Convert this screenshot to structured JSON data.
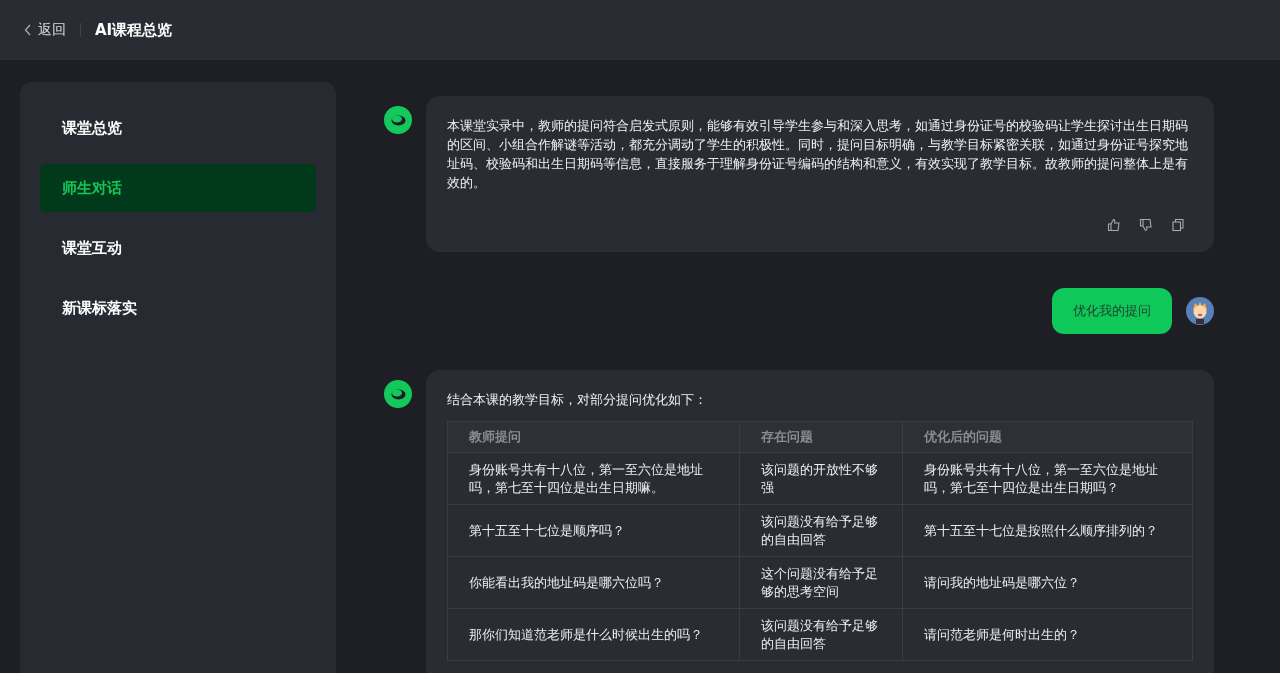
{
  "header": {
    "back": "返回",
    "title": "AI课程总览"
  },
  "sidebar": {
    "items": [
      {
        "label": "课堂总览",
        "selected": false
      },
      {
        "label": "师生对话",
        "selected": true
      },
      {
        "label": "课堂互动",
        "selected": false
      },
      {
        "label": "新课标落实",
        "selected": false
      }
    ]
  },
  "messages": [
    {
      "kind": "ai",
      "text": "本课堂实录中，教师的提问符合启发式原则，能够有效引导学生参与和深入思考，如通过身份证号的校验码让学生探讨出生日期码的区间、小组合作解谜等活动，都充分调动了学生的积极性。同时，提问目标明确，与教学目标紧密关联，如通过身份证号探究地址码、校验码和出生日期码等信息，直接服务于理解身份证号编码的结构和意义，有效实现了教学目标。故教师的提问整体上是有效的。"
    },
    {
      "kind": "user",
      "text": "优化我的提问"
    },
    {
      "kind": "ai_table",
      "text": "结合本课的教学目标，对部分提问优化如下：",
      "table": {
        "columns": [
          "教师提问",
          "存在问题",
          "优化后的问题"
        ],
        "rows": [
          [
            "身份账号共有十八位，第一至六位是地址吗，第七至十四位是出生日期嘛。",
            "该问题的开放性不够强",
            "身份账号共有十八位，第一至六位是地址吗，第七至十四位是出生日期吗？"
          ],
          [
            "第十五至十七位是顺序吗？",
            "该问题没有给予足够的自由回答",
            "第十五至十七位是按照什么顺序排列的？"
          ],
          [
            "你能看出我的地址码是哪六位吗？",
            "这个问题没有给予足够的思考空间",
            "请问我的地址码是哪六位？"
          ],
          [
            "那你们知道范老师是什么时候出生的吗？",
            "该问题没有给予足够的自由回答",
            "请问范老师是何时出生的？"
          ]
        ]
      }
    }
  ]
}
